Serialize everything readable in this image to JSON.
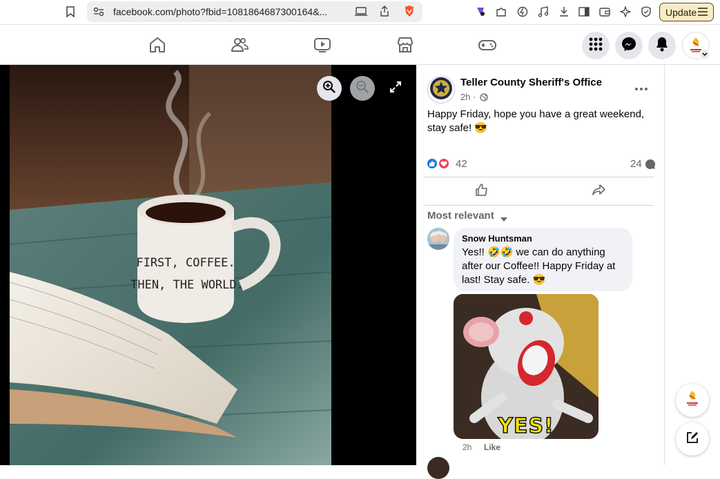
{
  "browser": {
    "url": "facebook.com/photo?fbid=1081864687300164&...",
    "update_label": "Update"
  },
  "post": {
    "page_name": "Teller County Sheriff's Office",
    "time": "2h ·",
    "text": "Happy Friday, hope you have a great weekend, stay safe! 😎",
    "reaction_count": "42",
    "comment_count": "24"
  },
  "comments": {
    "sort_label": "Most relevant",
    "items": [
      {
        "author": "Snow Huntsman",
        "text": "Yes!! 🤣🤣 we can do anything after our Coffee!! Happy Friday at last! Stay safe. 😎",
        "gif_caption": "YES!",
        "time": "2h",
        "like_label": "Like"
      }
    ]
  },
  "photo": {
    "mug_line1": "FIRST, COFFEE.",
    "mug_line2": "THEN, THE WORLD."
  },
  "colors": {
    "fb_blue": "#1877f2",
    "icon_gray": "#65676b",
    "bubble_bg": "#f0f2f5"
  }
}
